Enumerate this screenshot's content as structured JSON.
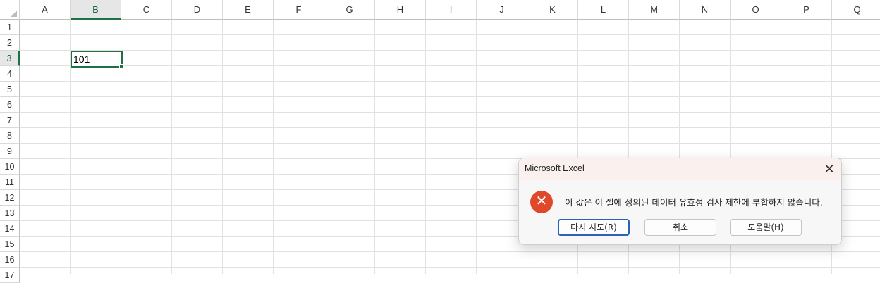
{
  "sheet": {
    "columns": [
      "A",
      "B",
      "C",
      "D",
      "E",
      "F",
      "G",
      "H",
      "I",
      "J",
      "K",
      "L",
      "M",
      "N",
      "O",
      "P",
      "Q"
    ],
    "rows": [
      "1",
      "2",
      "3",
      "4",
      "5",
      "6",
      "7",
      "8",
      "9",
      "10",
      "11",
      "12",
      "13",
      "14",
      "15",
      "16",
      "17"
    ],
    "selected_column": "B",
    "selected_row": "3",
    "active_cell_value": "101"
  },
  "dialog": {
    "title": "Microsoft Excel",
    "close_icon": "close-icon",
    "error_icon": "error-icon",
    "error_glyph": "✕",
    "message": "이 값은 이 셀에 정의된 데이터 유효성 검사 제한에 부합하지 않습니다.",
    "buttons": {
      "retry": "다시 시도(R)",
      "cancel": "취소",
      "help": "도움말(H)"
    }
  },
  "colors": {
    "selection_green": "#1e7145",
    "error_red": "#e0482b",
    "primary_button_border": "#2a63b8"
  }
}
